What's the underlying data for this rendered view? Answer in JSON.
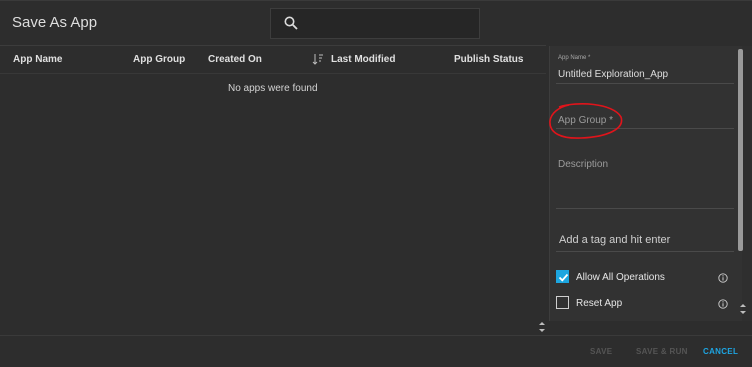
{
  "dialog": {
    "title": "Save As App"
  },
  "search": {
    "value": ""
  },
  "table": {
    "columns": [
      "App Name",
      "App Group",
      "Created On",
      "Last Modified",
      "Publish Status"
    ],
    "empty_message": "No apps were found"
  },
  "form": {
    "app_name_label": "App Name *",
    "app_name_value": "Untitled Exploration_App",
    "app_group_placeholder": "App Group *",
    "description_placeholder": "Description",
    "tag_placeholder": "Add a tag and hit enter",
    "options": [
      {
        "label": "Allow All Operations",
        "checked": true
      },
      {
        "label": "Reset App",
        "checked": false
      }
    ]
  },
  "footer": {
    "save_label": "SAVE",
    "save_run_label": "SAVE & RUN",
    "cancel_label": "CANCEL"
  },
  "colors": {
    "accent": "#1da5e3",
    "annotation": "#e0141b",
    "background": "#2d2d2d"
  }
}
